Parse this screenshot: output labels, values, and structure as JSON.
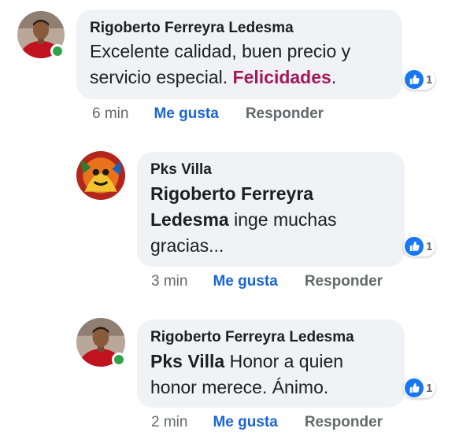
{
  "comments": [
    {
      "author": "Rigoberto Ferreyra Ledesma",
      "line1": "Excelente calidad, buen precio y",
      "line2_pre": "servicio especial. ",
      "highlight": "Felicidades",
      "line2_post": ".",
      "time": "6 min",
      "like_label": "Me gusta",
      "reply_label": "Responder",
      "reaction_count": "1",
      "avatar": "man-red-shirt-avatar",
      "online": true
    },
    {
      "author": "Pks Villa",
      "mention_line1": "Rigoberto Ferreyra",
      "mention_line2": "Ledesma",
      "text_line2": " inge muchas",
      "text_line3": "gracias...",
      "time": "3 min",
      "like_label": "Me gusta",
      "reply_label": "Responder",
      "reaction_count": "1",
      "avatar": "colorful-art-avatar",
      "online": false
    },
    {
      "author": "Rigoberto Ferreyra Ledesma",
      "mention": "Pks Villa",
      "text_line1": " Honor a quien",
      "text_line2": "honor merece. Ánimo.",
      "time": "2 min",
      "like_label": "Me gusta",
      "reply_label": "Responder",
      "reaction_count": "1",
      "avatar": "man-red-shirt-avatar",
      "online": true
    }
  ],
  "colors": {
    "bubble": "#f0f2f5",
    "like_link": "#1a65d6",
    "highlight": "#a3195b",
    "online": "#31a24c"
  }
}
